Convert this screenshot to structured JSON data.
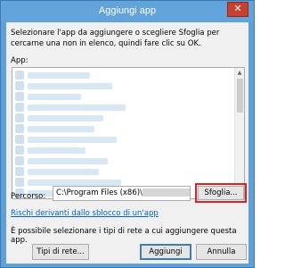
{
  "window": {
    "title": "Aggiungi app",
    "close_glyph": "✕"
  },
  "description": "Selezionare l'app da aggiungere o scegliere Sfoglia per cercarne una non in elenco, quindi fare clic su OK.",
  "app_list": {
    "label": "App:",
    "scroll_up_glyph": "▲",
    "scroll_down_glyph": "▼",
    "items": [
      {
        "name_width": 70
      },
      {
        "name_width": 95
      },
      {
        "name_width": 60
      },
      {
        "name_width": 110
      },
      {
        "name_width": 85
      },
      {
        "name_width": 75
      },
      {
        "name_width": 100
      },
      {
        "name_width": 65
      },
      {
        "name_width": 90
      },
      {
        "name_width": 80
      },
      {
        "name_width": 105
      },
      {
        "name_width": 70
      }
    ]
  },
  "path": {
    "label": "Percorso:",
    "value": "C:\\Program Files (x86)\\",
    "browse_button": "Sfoglia..."
  },
  "risk_link": "Rischi derivanti dallo sblocco di un'app",
  "network_text": "È possibile selezionare i tipi di rete a cui aggiungere questa app.",
  "buttons": {
    "network_types": "Tipi di rete...",
    "add": "Aggiungi",
    "cancel": "Annulla"
  },
  "colors": {
    "titlebar": "#62a3dc",
    "close": "#c8402f",
    "highlight": "#e11f1f",
    "link": "#0066cc"
  }
}
